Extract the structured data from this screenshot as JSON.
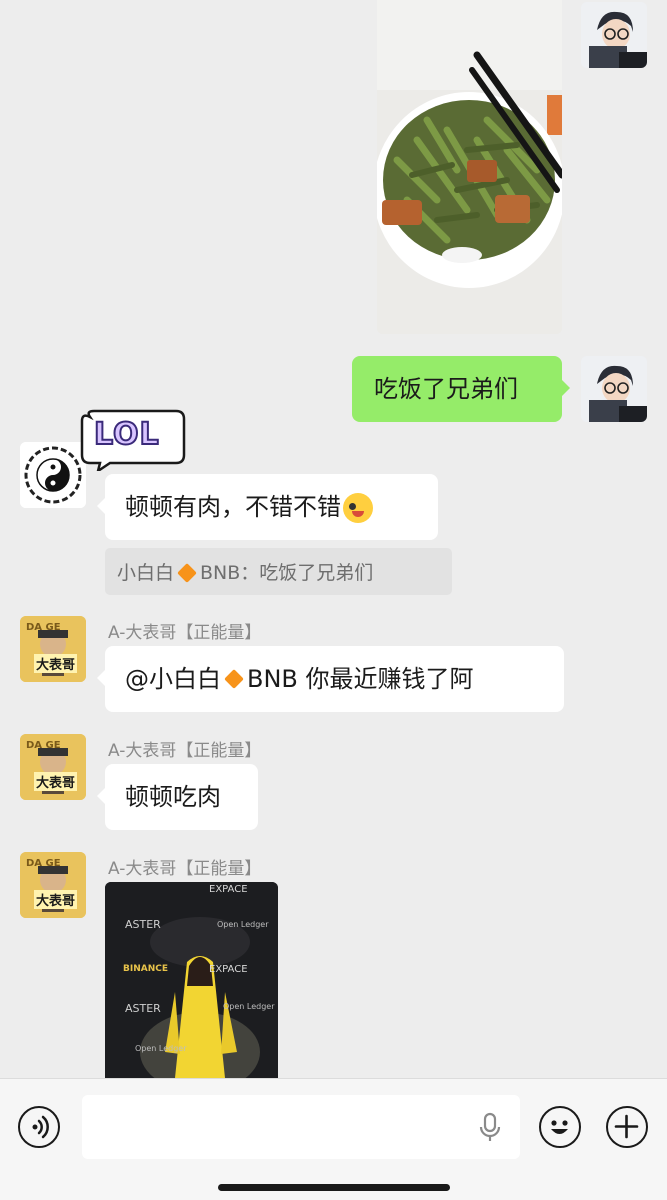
{
  "messages": {
    "self_text": "吃饭了兄弟们",
    "reply_text": "顿顿有肉，不错不错",
    "sticker_text": "LOL",
    "quote_prefix": "小白白",
    "quote_suffix": "BNB：吃饭了兄弟们",
    "sender_name": "A-大表哥【正能量】",
    "mention_prefix": "@小白白",
    "mention_suffix": "BNB  你最近赚钱了阿",
    "msg_eat_meat": "顿顿吃肉"
  },
  "event_photo": {
    "logos": [
      "ASTER",
      "Open Ledger",
      "BINANCE",
      "EXPACE",
      "ASTER",
      "Open Ledger",
      "EXPACE",
      "Open Ledger"
    ]
  },
  "avatars": {
    "daibiaoge_text": "大表哥",
    "daibiaoge_top": "DA GE"
  },
  "colors": {
    "background": "#ededed",
    "self_bubble": "#95ec69",
    "other_bubble": "#ffffff",
    "bnb_diamond": "#f7931a"
  }
}
